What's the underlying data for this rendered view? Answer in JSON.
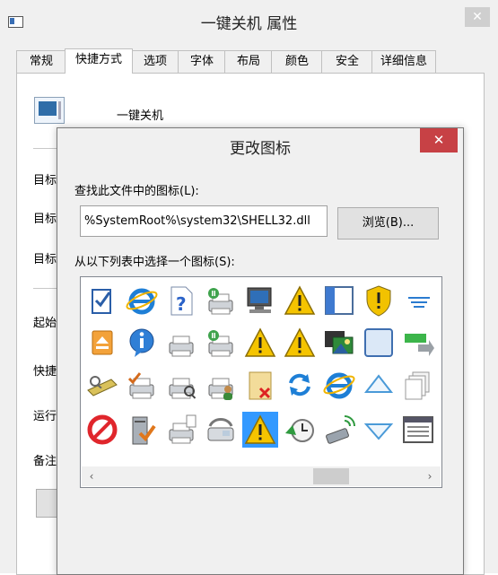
{
  "window": {
    "title": "一键关机 属性",
    "close_glyph": "✕",
    "tabs": [
      "常规",
      "快捷方式",
      "选项",
      "字体",
      "布局",
      "颜色",
      "安全",
      "详细信息"
    ],
    "active_tab": "快捷方式",
    "shortcut_name": "一键关机",
    "side_labels": [
      "目标",
      "目标",
      "目标",
      "起始",
      "快捷",
      "运行",
      "备注"
    ]
  },
  "dialog": {
    "title": "更改图标",
    "close_glyph": "✕",
    "find_label": "查找此文件中的图标(L):",
    "path_value": "%SystemRoot%\\system32\\SHELL32.dll",
    "browse_label": "浏览(B)...",
    "select_label": "从以下列表中选择一个图标(S):",
    "selected_icon": "warning-icon-selected",
    "icons": [
      [
        "checklist-icon",
        "internet-explorer-icon",
        "help-file-icon",
        "printer-green-icon",
        "computer-monitor-icon",
        "warning-icon",
        "window-pane-icon",
        "security-shield-icon",
        "lines-icon"
      ],
      [
        "eject-icon",
        "info-icon",
        "printer-icon",
        "printer-green-icon",
        "warning-icon",
        "warning-icon",
        "film-photo-icon",
        "blank-window-icon",
        "transfer-arrow-icon"
      ],
      [
        "scanner-icon",
        "printer-check-icon",
        "printer-search-icon",
        "printer-users-icon",
        "folder-delete-icon",
        "refresh-icon",
        "internet-explorer-icon",
        "triangle-up-icon",
        "stacked-pages-icon"
      ],
      [
        "no-entry-icon",
        "server-check-icon",
        "printer-document-icon",
        "fax-icon",
        "warning-icon-selected",
        "clock-back-icon",
        "usb-wireless-icon",
        "triangle-down-icon",
        "window-list-icon"
      ]
    ],
    "scroll_left_glyph": "‹",
    "scroll_right_glyph": "›"
  }
}
